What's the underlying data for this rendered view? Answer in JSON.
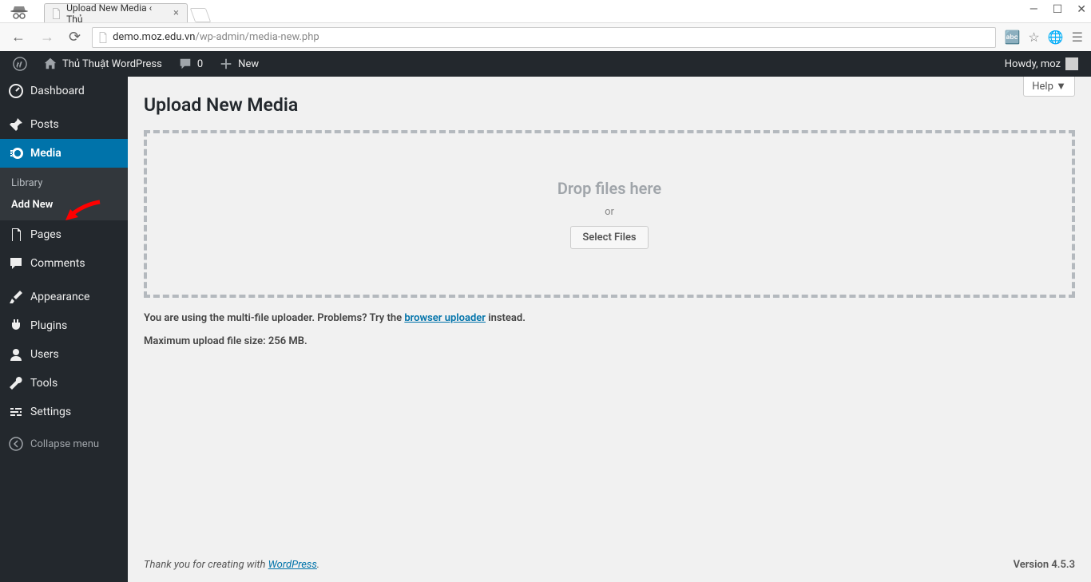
{
  "browser": {
    "tab_title": "Upload New Media ‹ Thủ",
    "url_domain": "demo.moz.edu.vn",
    "url_path": "/wp-admin/media-new.php"
  },
  "adminbar": {
    "site_name": "Thủ Thuật WordPress",
    "comments_count": "0",
    "new_label": "New",
    "howdy": "Howdy, moz"
  },
  "sidebar": {
    "dashboard": "Dashboard",
    "posts": "Posts",
    "media": "Media",
    "media_sub": {
      "library": "Library",
      "addnew": "Add New"
    },
    "pages": "Pages",
    "comments": "Comments",
    "appearance": "Appearance",
    "plugins": "Plugins",
    "users": "Users",
    "tools": "Tools",
    "settings": "Settings",
    "collapse": "Collapse menu"
  },
  "content": {
    "help": "Help",
    "title": "Upload New Media",
    "drop": "Drop files here",
    "or": "or",
    "select": "Select Files",
    "info_prefix": "You are using the multi-file uploader. Problems? Try the ",
    "info_link": "browser uploader",
    "info_suffix": " instead.",
    "max": "Maximum upload file size: 256 MB."
  },
  "footer": {
    "thank": "Thank you for creating with ",
    "wp": "WordPress",
    "dot": ".",
    "version": "Version 4.5.3"
  }
}
